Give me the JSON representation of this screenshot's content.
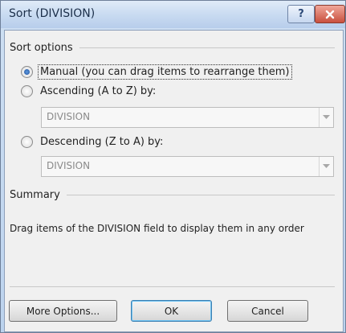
{
  "window": {
    "title": "Sort (DIVISION)"
  },
  "title_buttons": {
    "help": "?"
  },
  "sort_options": {
    "heading": "Sort options",
    "manual": {
      "label": "Manual (you can drag items to rearrange them)",
      "selected": true
    },
    "ascending": {
      "label": "Ascending (A to Z) by:",
      "selected": false,
      "field": "DIVISION"
    },
    "descending": {
      "label": "Descending (Z to A) by:",
      "selected": false,
      "field": "DIVISION"
    }
  },
  "summary": {
    "heading": "Summary",
    "text": "Drag items of the DIVISION field to display them in any order"
  },
  "buttons": {
    "more_options": "More Options...",
    "ok": "OK",
    "cancel": "Cancel"
  },
  "colors": {
    "accent": "#3c7fb1",
    "close": "#c9503e",
    "radio_dot": "#1f4f9a"
  }
}
